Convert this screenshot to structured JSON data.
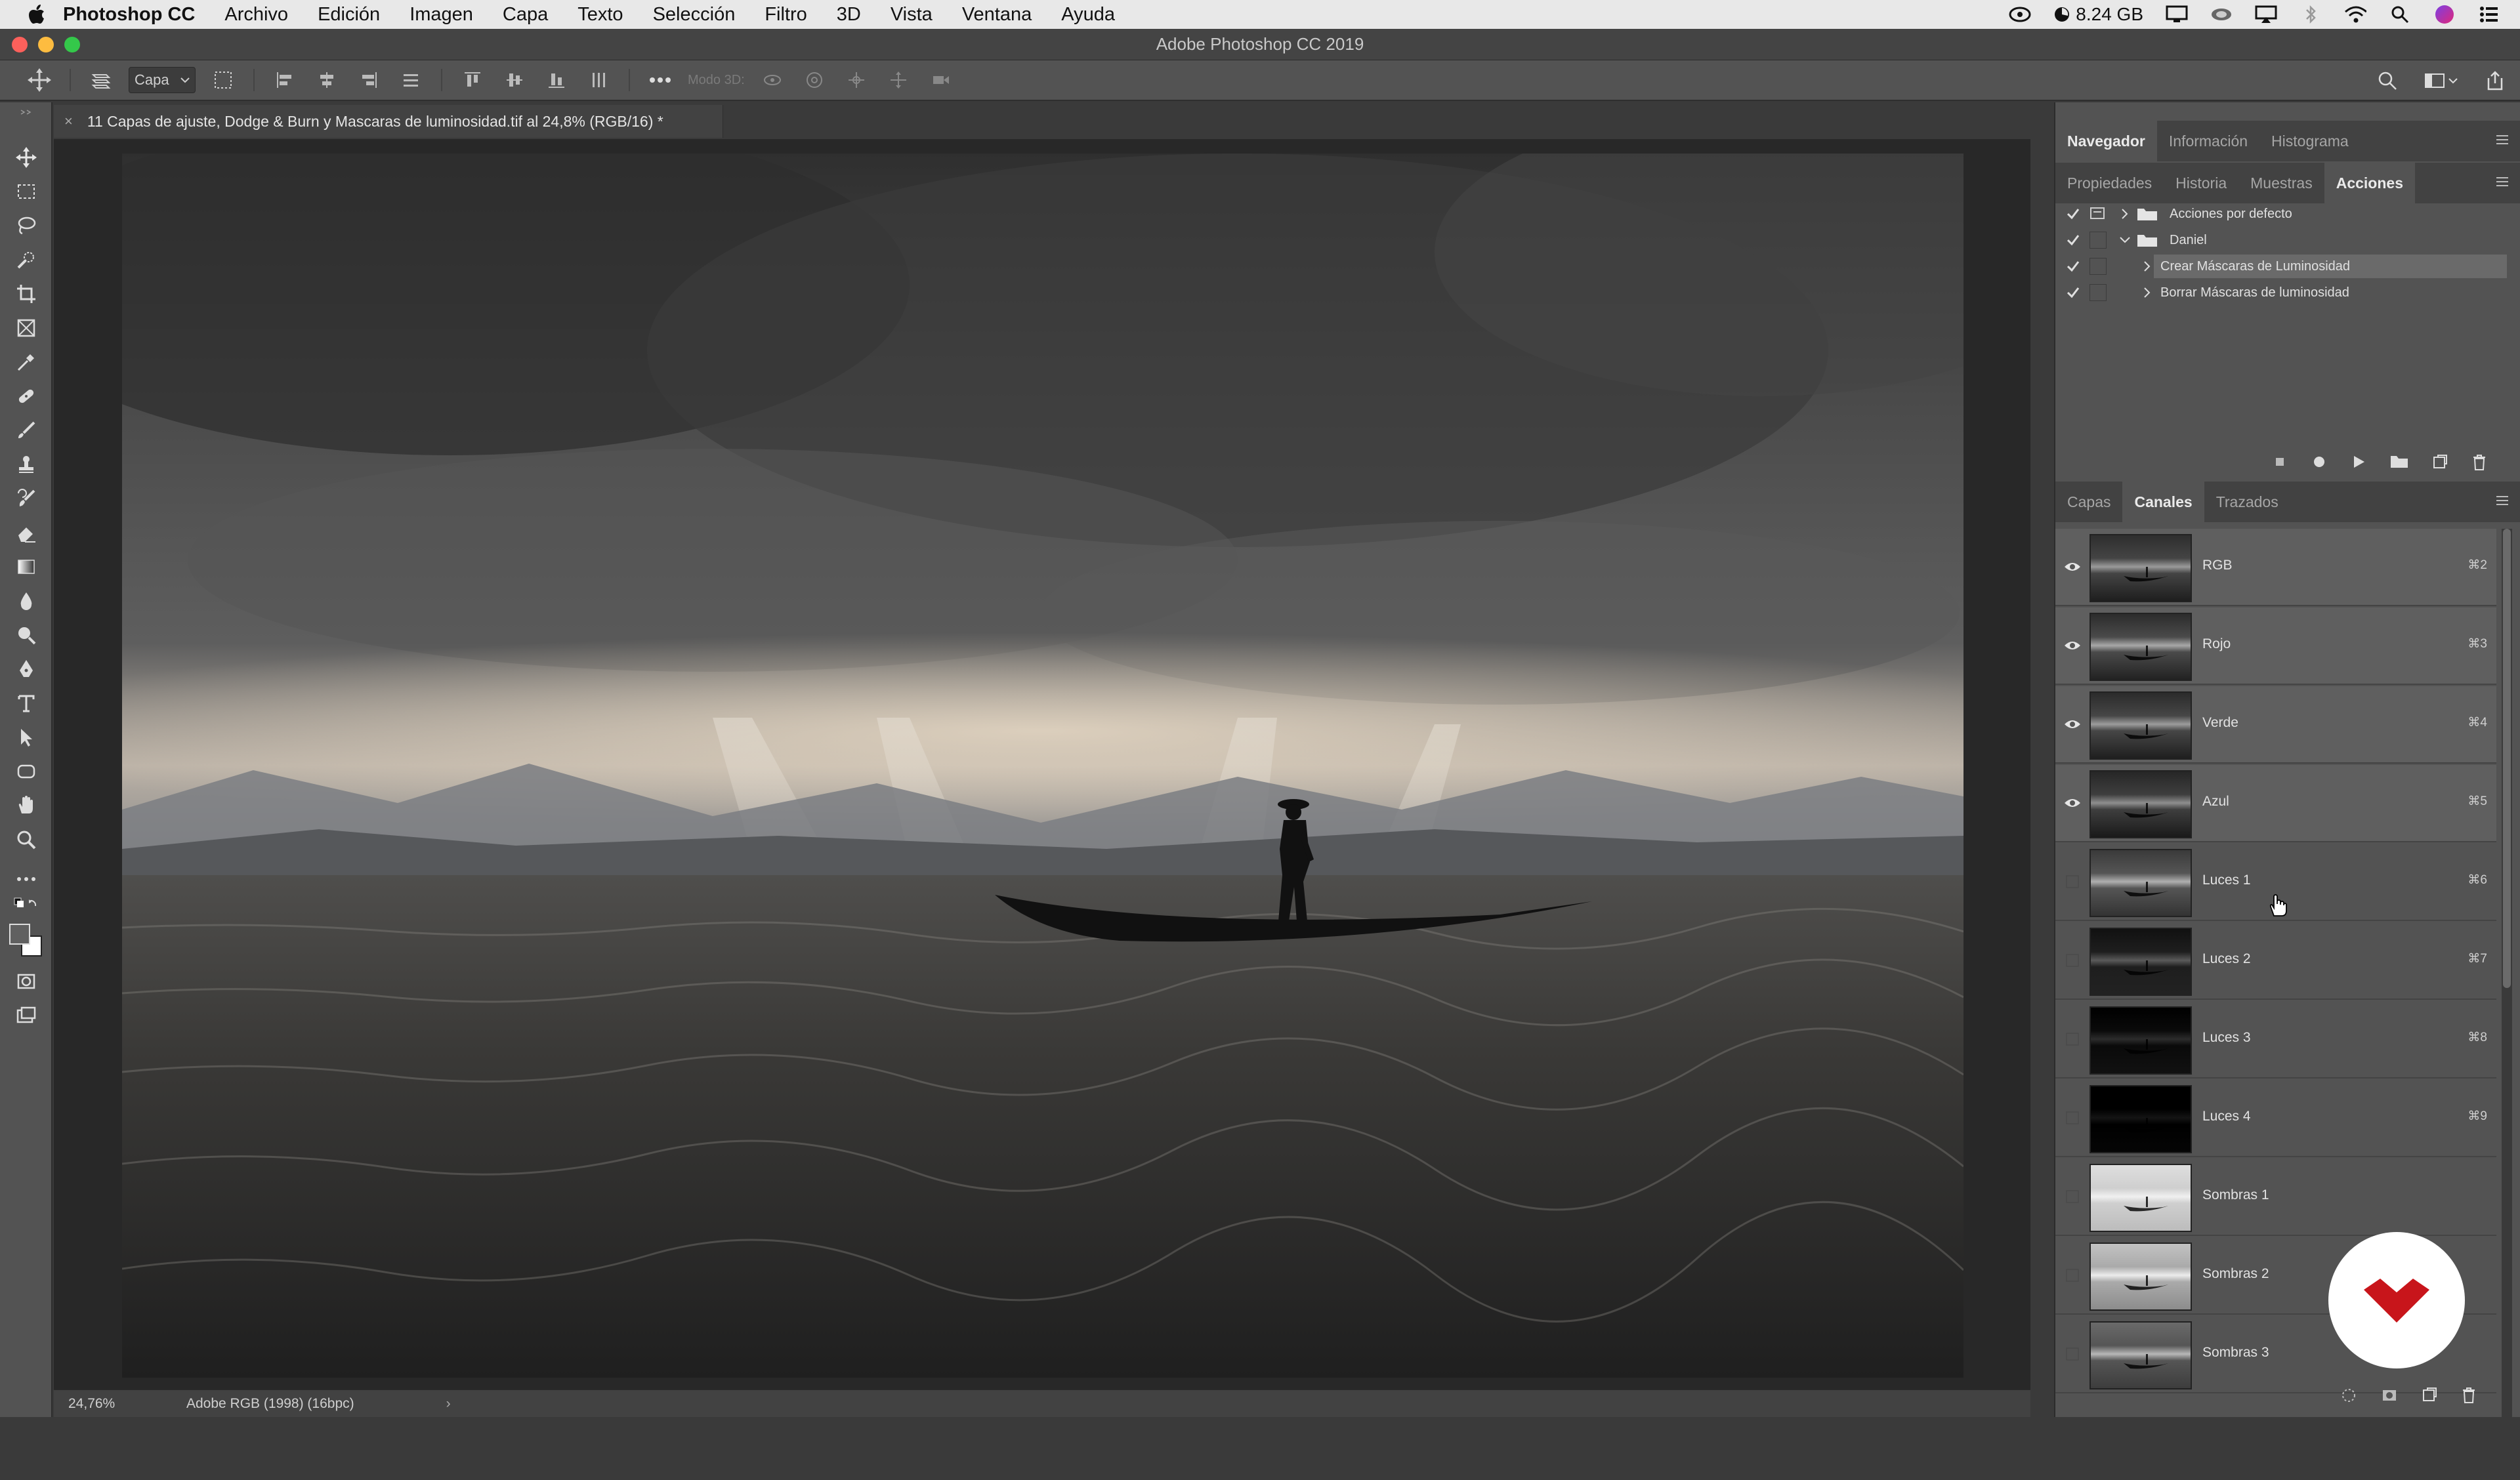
{
  "menubar": {
    "app_name": "Photoshop CC",
    "items": [
      "Archivo",
      "Edición",
      "Imagen",
      "Capa",
      "Texto",
      "Selección",
      "Filtro",
      "3D",
      "Vista",
      "Ventana",
      "Ayuda"
    ],
    "memory": "8.24 GB"
  },
  "window": {
    "title": "Adobe Photoshop CC 2019"
  },
  "options": {
    "layer_select": "Capa",
    "mode3d_label": "Modo 3D:"
  },
  "document": {
    "tab_title": "11 Capas de ajuste, Dodge & Burn y Mascaras de luminosidad.tif al 24,8% (RGB/16) *",
    "close_symbol": "×"
  },
  "status": {
    "zoom": "24,76%",
    "color_profile": "Adobe RGB (1998) (16bpc)",
    "arrow": "›"
  },
  "top_panel": {
    "tabs": [
      "Navegador",
      "Información",
      "Histograma"
    ],
    "active": "Navegador"
  },
  "mid_panel": {
    "tabs": [
      "Propiedades",
      "Historia",
      "Muestras",
      "Acciones"
    ],
    "active": "Acciones",
    "actions": [
      {
        "label": "Acciones por defecto",
        "type": "set",
        "expanded": false
      },
      {
        "label": "Daniel",
        "type": "set",
        "expanded": true
      },
      {
        "label": "Crear Máscaras de Luminosidad",
        "type": "action",
        "selected": true
      },
      {
        "label": "Borrar Máscaras de luminosidad",
        "type": "action",
        "selected": false
      }
    ]
  },
  "channels_panel": {
    "tabs": [
      "Capas",
      "Canales",
      "Trazados"
    ],
    "active": "Canales",
    "channels": [
      {
        "name": "RGB",
        "shortcut": "⌘2",
        "visible": true
      },
      {
        "name": "Rojo",
        "shortcut": "⌘3",
        "visible": true
      },
      {
        "name": "Verde",
        "shortcut": "⌘4",
        "visible": true
      },
      {
        "name": "Azul",
        "shortcut": "⌘5",
        "visible": true
      },
      {
        "name": "Luces 1",
        "shortcut": "⌘6",
        "visible": false
      },
      {
        "name": "Luces 2",
        "shortcut": "⌘7",
        "visible": false
      },
      {
        "name": "Luces 3",
        "shortcut": "⌘8",
        "visible": false
      },
      {
        "name": "Luces 4",
        "shortcut": "⌘9",
        "visible": false
      },
      {
        "name": "Sombras 1",
        "shortcut": "",
        "visible": false
      },
      {
        "name": "Sombras 2",
        "shortcut": "",
        "visible": false
      },
      {
        "name": "Sombras 3",
        "shortcut": "",
        "visible": false
      }
    ]
  },
  "colors": {
    "accent_red": "#c8151b",
    "panel_bg": "#535353",
    "dark_bg": "#282828"
  }
}
